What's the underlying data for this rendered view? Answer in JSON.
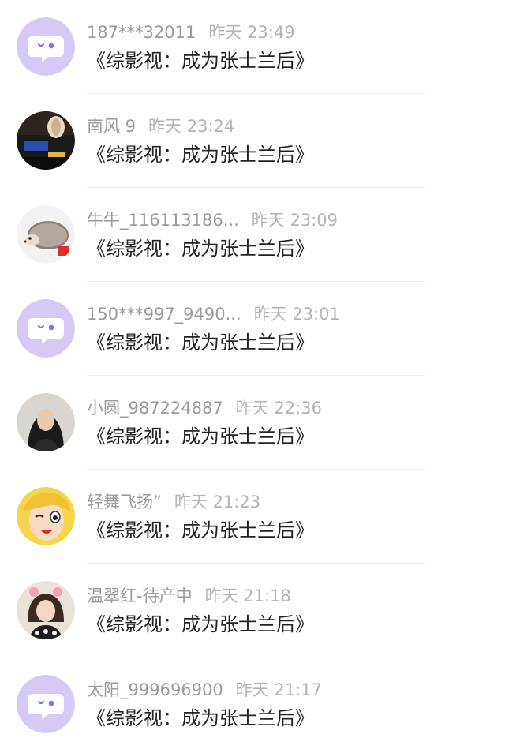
{
  "colors": {
    "default_avatar_bg": "#d7c9f5",
    "default_avatar_glyph": "#ffffff",
    "default_avatar_eye": "#8a6fd3",
    "name_text": "#9b9b9b",
    "time_text": "#b3b3b3",
    "title_text": "#222222",
    "divider": "#ededed"
  },
  "items": [
    {
      "name": "187***32011",
      "time": "昨天 23:49",
      "title": "《综影视：成为张士兰后》",
      "avatar": "default-chat-avatar-icon"
    },
    {
      "name": "南风 9",
      "time": "昨天 23:24",
      "title": "《综影视：成为张士兰后》",
      "avatar": "lantern-photo-avatar"
    },
    {
      "name": "牛牛_116113186...",
      "time": "昨天 23:09",
      "title": "《综影视：成为张士兰后》",
      "avatar": "hedgehog-photo-avatar"
    },
    {
      "name": "150***997_9490...",
      "time": "昨天 23:01",
      "title": "《综影视：成为张士兰后》",
      "avatar": "default-chat-avatar-icon"
    },
    {
      "name": "小圆_987224887",
      "time": "昨天 22:36",
      "title": "《综影视：成为张士兰后》",
      "avatar": "woman-photo-avatar"
    },
    {
      "name": "轻舞飞扬”",
      "time": "昨天 21:23",
      "title": "《综影视：成为张士兰后》",
      "avatar": "winking-cartoon-avatar"
    },
    {
      "name": "温翠红-待产中",
      "time": "昨天 21:18",
      "title": "《综影视：成为张士兰后》",
      "avatar": "girl-photo-avatar"
    },
    {
      "name": "太阳_999696900",
      "time": "昨天 21:17",
      "title": "《综影视：成为张士兰后》",
      "avatar": "default-chat-avatar-icon"
    }
  ]
}
